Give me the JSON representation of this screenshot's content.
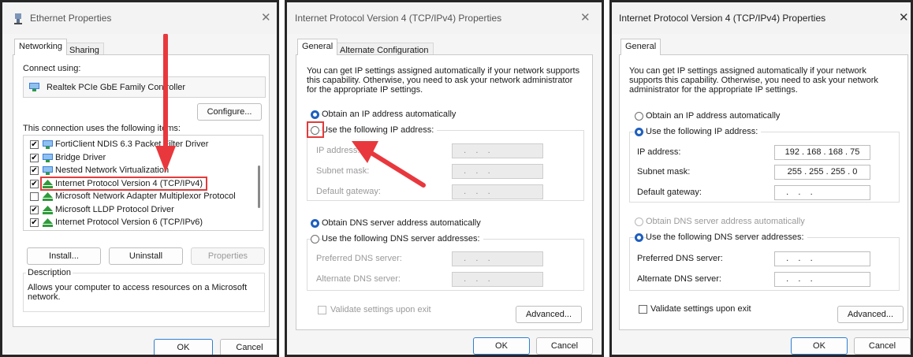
{
  "panel1": {
    "title": "Ethernet Properties",
    "tabs": [
      "Networking",
      "Sharing"
    ],
    "connect_using_label": "Connect using:",
    "adapter_name": "Realtek PCIe GbE Family Controller",
    "configure_label": "Configure...",
    "items_label": "This connection uses the following items:",
    "items": [
      {
        "label": "FortiClient NDIS 6.3 Packet Filter Driver",
        "checked": true,
        "icon": "network-monitor-icon"
      },
      {
        "label": "Bridge Driver",
        "checked": true,
        "icon": "network-monitor-icon"
      },
      {
        "label": "Nested Network Virtualization",
        "checked": true,
        "icon": "network-monitor-icon"
      },
      {
        "label": "Internet Protocol Version 4 (TCP/IPv4)",
        "checked": true,
        "icon": "protocol-icon",
        "highlighted": true
      },
      {
        "label": "Microsoft Network Adapter Multiplexor Protocol",
        "checked": false,
        "icon": "protocol-icon"
      },
      {
        "label": "Microsoft LLDP Protocol Driver",
        "checked": true,
        "icon": "protocol-icon"
      },
      {
        "label": "Internet Protocol Version 6 (TCP/IPv6)",
        "checked": true,
        "icon": "protocol-icon"
      }
    ],
    "install_label": "Install...",
    "uninstall_label": "Uninstall",
    "properties_label": "Properties",
    "description_title": "Description",
    "description_text": "Allows your computer to access resources on a Microsoft network.",
    "ok_label": "OK",
    "cancel_label": "Cancel"
  },
  "panel2": {
    "title": "Internet Protocol Version 4 (TCP/IPv4) Properties",
    "tabs": [
      "General",
      "Alternate Configuration"
    ],
    "intro": "You can get IP settings assigned automatically if your network supports this capability. Otherwise, you need to ask your network administrator for the appropriate IP settings.",
    "obtain_ip_auto": "Obtain an IP address automatically",
    "use_following_ip": "Use the following IP address:",
    "ip_address_label": "IP address:",
    "subnet_mask_label": "Subnet mask:",
    "default_gateway_label": "Default gateway:",
    "empty_ip": "  .    .    .",
    "obtain_dns_auto": "Obtain DNS server address automatically",
    "use_following_dns": "Use the following DNS server addresses:",
    "preferred_dns_label": "Preferred DNS server:",
    "alternate_dns_label": "Alternate DNS server:",
    "validate_label": "Validate settings upon exit",
    "advanced_label": "Advanced...",
    "ok_label": "OK",
    "cancel_label": "Cancel"
  },
  "panel3": {
    "title": "Internet Protocol Version 4 (TCP/IPv4) Properties",
    "tabs": [
      "General"
    ],
    "intro": "You can get IP settings assigned automatically if your network supports this capability. Otherwise, you need to ask your network administrator for the appropriate IP settings.",
    "obtain_ip_auto": "Obtain an IP address automatically",
    "use_following_ip": "Use the following IP address:",
    "ip_address_label": "IP address:",
    "ip_address_value": "192 . 168 . 168 . 75",
    "subnet_mask_label": "Subnet mask:",
    "subnet_mask_value": "255 . 255 . 255 . 0",
    "default_gateway_label": "Default gateway:",
    "empty_ip": "  .    .    .",
    "obtain_dns_auto": "Obtain DNS server address automatically",
    "use_following_dns": "Use the following DNS server addresses:",
    "preferred_dns_label": "Preferred DNS server:",
    "alternate_dns_label": "Alternate DNS server:",
    "validate_label": "Validate settings upon exit",
    "advanced_label": "Advanced...",
    "ok_label": "OK",
    "cancel_label": "Cancel"
  },
  "colors": {
    "annotation_red": "#e8383d",
    "accent_blue": "#1f5fbf",
    "highlight_box": "#e23b3b"
  }
}
